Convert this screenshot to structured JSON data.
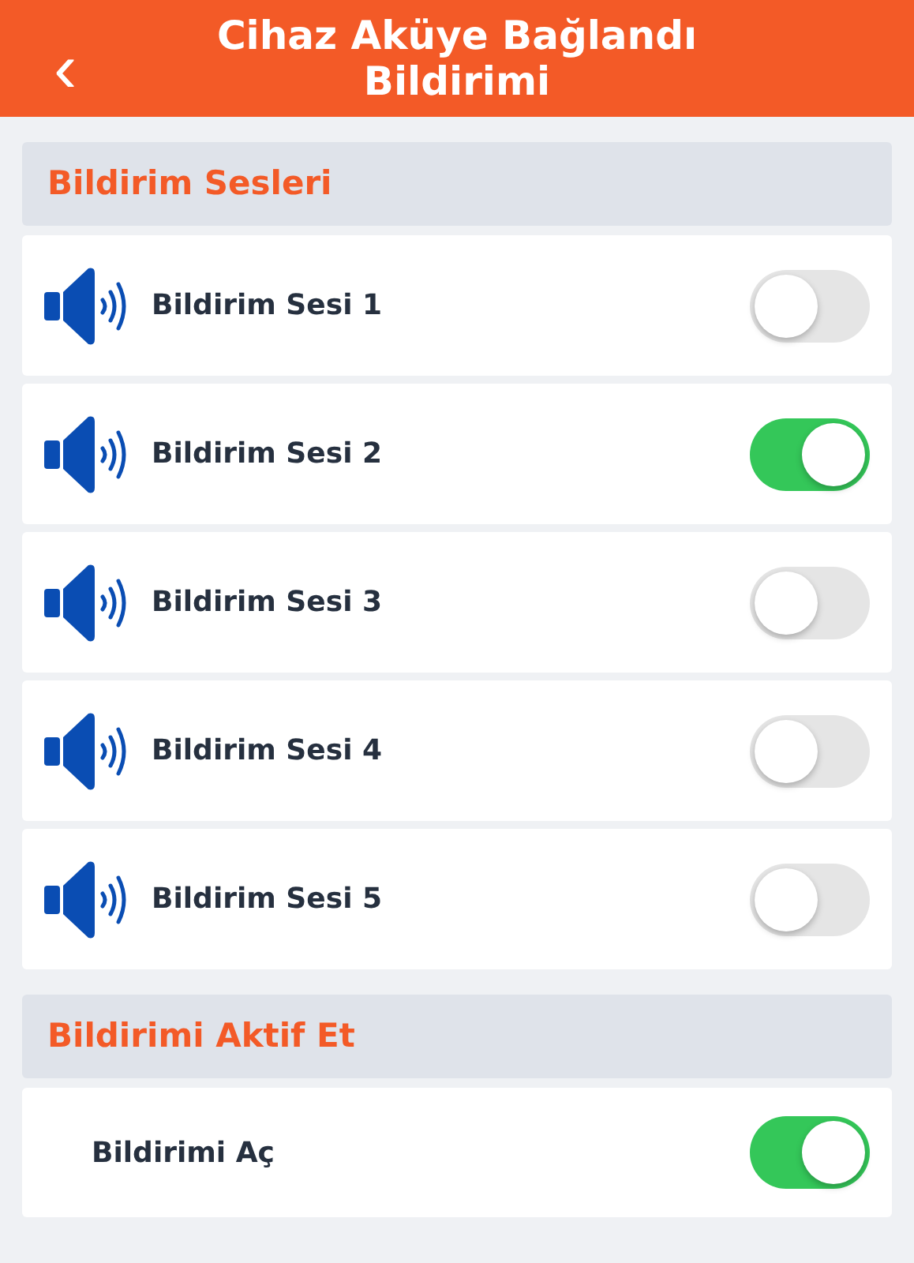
{
  "header": {
    "back": "‹",
    "title": "Cihaz Aküye Bağlandı Bildirimi"
  },
  "sections": [
    {
      "title": "Bildirim Sesleri",
      "items": [
        {
          "kind": "sound",
          "label": "Bildirim Sesi 1",
          "on": false
        },
        {
          "kind": "sound",
          "label": "Bildirim Sesi 2",
          "on": true
        },
        {
          "kind": "sound",
          "label": "Bildirim Sesi 3",
          "on": false
        },
        {
          "kind": "sound",
          "label": "Bildirim Sesi 4",
          "on": false
        },
        {
          "kind": "sound",
          "label": "Bildirim Sesi 5",
          "on": false
        }
      ]
    },
    {
      "title": "Bildirimi Aktif Et",
      "items": [
        {
          "kind": "plain",
          "label": "Bildirimi Aç",
          "on": true
        }
      ]
    }
  ]
}
